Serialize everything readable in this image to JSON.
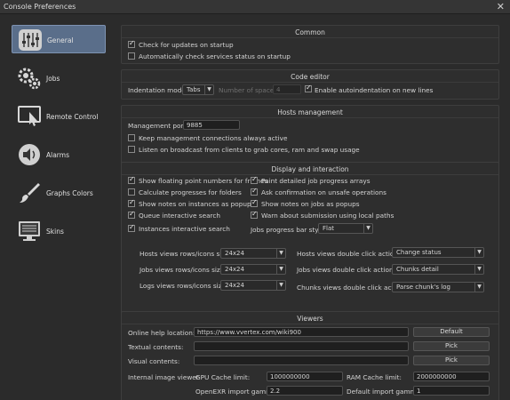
{
  "window": {
    "title": "Console Preferences",
    "close_glyph": "✕"
  },
  "sidebar": {
    "items": [
      {
        "label": "General",
        "icon": "sliders-icon"
      },
      {
        "label": "Jobs",
        "icon": "gears-icon"
      },
      {
        "label": "Remote Control",
        "icon": "remote-screen-icon"
      },
      {
        "label": "Alarms",
        "icon": "speaker-icon"
      },
      {
        "label": "Graphs Colors",
        "icon": "brush-icon"
      },
      {
        "label": "Skins",
        "icon": "monitor-icon"
      }
    ]
  },
  "common": {
    "title": "Common",
    "check_updates": "Check for updates on startup",
    "auto_check_services": "Automatically check services status on startup"
  },
  "code_editor": {
    "title": "Code editor",
    "indentation_label": "Indentation mode:",
    "indentation_value": "Tabs",
    "spaces_label": "Number of spaces:",
    "spaces_value": "4",
    "autoindent": "Enable autoindentation on new lines"
  },
  "hosts": {
    "title": "Hosts management",
    "port_label": "Management port:",
    "port_value": "9885",
    "keep_connections": "Keep management connections always active",
    "listen_broadcast": "Listen on broadcast from clients to grab cores, ram and swap usage"
  },
  "display": {
    "title": "Display and interaction",
    "floating_point": "Show floating point numbers for frames",
    "calc_progress": "Calculate progresses for folders",
    "notes_instances": "Show notes on instances as popups",
    "queue_search": "Queue interactive search",
    "instances_search": "Instances interactive search",
    "paint_progress": "Paint detailed job progress arrays",
    "ask_unsafe": "Ask confirmation on unsafe operations",
    "notes_jobs": "Show notes on jobs as popups",
    "warn_local_paths": "Warn about submission using local paths",
    "progress_bar_label": "Jobs progress bar style:",
    "progress_bar_value": "Flat",
    "hosts_rows_label": "Hosts views rows/icons size:",
    "hosts_rows_value": "24x24",
    "jobs_rows_label": "Jobs views rows/icons size:",
    "jobs_rows_value": "24x24",
    "logs_rows_label": "Logs views rows/icons size:",
    "logs_rows_value": "24x24",
    "hosts_dbl_label": "Hosts views double click action:",
    "hosts_dbl_value": "Change status",
    "jobs_dbl_label": "Jobs views double click action:",
    "jobs_dbl_value": "Chunks detail",
    "chunks_dbl_label": "Chunks views double click action:",
    "chunks_dbl_value": "Parse chunk's log"
  },
  "viewers": {
    "title": "Viewers",
    "online_help_label": "Online help location:",
    "online_help_value": "https://www.vvertex.com/wiki900",
    "default_button": "Default",
    "textual_label": "Textual contents:",
    "textual_value": "",
    "pick_button": "Pick",
    "visual_label": "Visual contents:",
    "visual_value": "",
    "internal_viewer_label": "Internal image viewer",
    "gpu_cache_label": "GPU Cache limit:",
    "gpu_cache_value": "1000000000",
    "ram_cache_label": "RAM Cache limit:",
    "ram_cache_value": "2000000000",
    "openexr_gamma_label": "OpenEXR import gamma:",
    "openexr_gamma_value": "2.2",
    "default_gamma_label": "Default import gamma:",
    "default_gamma_value": "1"
  },
  "colors": {
    "selected_bg": "#5a6e8a",
    "window_bg": "#2b2b2b"
  }
}
